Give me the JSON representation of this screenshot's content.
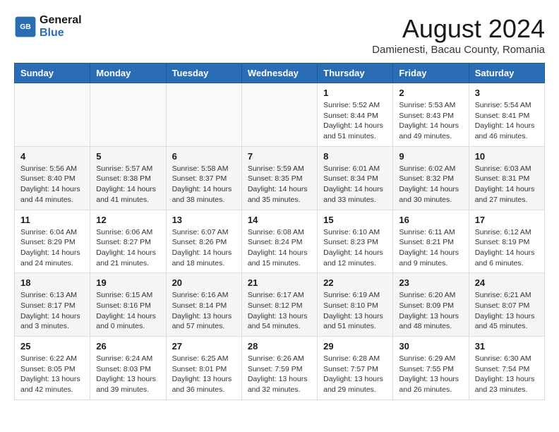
{
  "header": {
    "logo_line1": "General",
    "logo_line2": "Blue",
    "month_year": "August 2024",
    "location": "Damienesti, Bacau County, Romania"
  },
  "weekdays": [
    "Sunday",
    "Monday",
    "Tuesday",
    "Wednesday",
    "Thursday",
    "Friday",
    "Saturday"
  ],
  "weeks": [
    [
      {
        "day": "",
        "info": ""
      },
      {
        "day": "",
        "info": ""
      },
      {
        "day": "",
        "info": ""
      },
      {
        "day": "",
        "info": ""
      },
      {
        "day": "1",
        "info": "Sunrise: 5:52 AM\nSunset: 8:44 PM\nDaylight: 14 hours\nand 51 minutes."
      },
      {
        "day": "2",
        "info": "Sunrise: 5:53 AM\nSunset: 8:43 PM\nDaylight: 14 hours\nand 49 minutes."
      },
      {
        "day": "3",
        "info": "Sunrise: 5:54 AM\nSunset: 8:41 PM\nDaylight: 14 hours\nand 46 minutes."
      }
    ],
    [
      {
        "day": "4",
        "info": "Sunrise: 5:56 AM\nSunset: 8:40 PM\nDaylight: 14 hours\nand 44 minutes."
      },
      {
        "day": "5",
        "info": "Sunrise: 5:57 AM\nSunset: 8:38 PM\nDaylight: 14 hours\nand 41 minutes."
      },
      {
        "day": "6",
        "info": "Sunrise: 5:58 AM\nSunset: 8:37 PM\nDaylight: 14 hours\nand 38 minutes."
      },
      {
        "day": "7",
        "info": "Sunrise: 5:59 AM\nSunset: 8:35 PM\nDaylight: 14 hours\nand 35 minutes."
      },
      {
        "day": "8",
        "info": "Sunrise: 6:01 AM\nSunset: 8:34 PM\nDaylight: 14 hours\nand 33 minutes."
      },
      {
        "day": "9",
        "info": "Sunrise: 6:02 AM\nSunset: 8:32 PM\nDaylight: 14 hours\nand 30 minutes."
      },
      {
        "day": "10",
        "info": "Sunrise: 6:03 AM\nSunset: 8:31 PM\nDaylight: 14 hours\nand 27 minutes."
      }
    ],
    [
      {
        "day": "11",
        "info": "Sunrise: 6:04 AM\nSunset: 8:29 PM\nDaylight: 14 hours\nand 24 minutes."
      },
      {
        "day": "12",
        "info": "Sunrise: 6:06 AM\nSunset: 8:27 PM\nDaylight: 14 hours\nand 21 minutes."
      },
      {
        "day": "13",
        "info": "Sunrise: 6:07 AM\nSunset: 8:26 PM\nDaylight: 14 hours\nand 18 minutes."
      },
      {
        "day": "14",
        "info": "Sunrise: 6:08 AM\nSunset: 8:24 PM\nDaylight: 14 hours\nand 15 minutes."
      },
      {
        "day": "15",
        "info": "Sunrise: 6:10 AM\nSunset: 8:23 PM\nDaylight: 14 hours\nand 12 minutes."
      },
      {
        "day": "16",
        "info": "Sunrise: 6:11 AM\nSunset: 8:21 PM\nDaylight: 14 hours\nand 9 minutes."
      },
      {
        "day": "17",
        "info": "Sunrise: 6:12 AM\nSunset: 8:19 PM\nDaylight: 14 hours\nand 6 minutes."
      }
    ],
    [
      {
        "day": "18",
        "info": "Sunrise: 6:13 AM\nSunset: 8:17 PM\nDaylight: 14 hours\nand 3 minutes."
      },
      {
        "day": "19",
        "info": "Sunrise: 6:15 AM\nSunset: 8:16 PM\nDaylight: 14 hours\nand 0 minutes."
      },
      {
        "day": "20",
        "info": "Sunrise: 6:16 AM\nSunset: 8:14 PM\nDaylight: 13 hours\nand 57 minutes."
      },
      {
        "day": "21",
        "info": "Sunrise: 6:17 AM\nSunset: 8:12 PM\nDaylight: 13 hours\nand 54 minutes."
      },
      {
        "day": "22",
        "info": "Sunrise: 6:19 AM\nSunset: 8:10 PM\nDaylight: 13 hours\nand 51 minutes."
      },
      {
        "day": "23",
        "info": "Sunrise: 6:20 AM\nSunset: 8:09 PM\nDaylight: 13 hours\nand 48 minutes."
      },
      {
        "day": "24",
        "info": "Sunrise: 6:21 AM\nSunset: 8:07 PM\nDaylight: 13 hours\nand 45 minutes."
      }
    ],
    [
      {
        "day": "25",
        "info": "Sunrise: 6:22 AM\nSunset: 8:05 PM\nDaylight: 13 hours\nand 42 minutes."
      },
      {
        "day": "26",
        "info": "Sunrise: 6:24 AM\nSunset: 8:03 PM\nDaylight: 13 hours\nand 39 minutes."
      },
      {
        "day": "27",
        "info": "Sunrise: 6:25 AM\nSunset: 8:01 PM\nDaylight: 13 hours\nand 36 minutes."
      },
      {
        "day": "28",
        "info": "Sunrise: 6:26 AM\nSunset: 7:59 PM\nDaylight: 13 hours\nand 32 minutes."
      },
      {
        "day": "29",
        "info": "Sunrise: 6:28 AM\nSunset: 7:57 PM\nDaylight: 13 hours\nand 29 minutes."
      },
      {
        "day": "30",
        "info": "Sunrise: 6:29 AM\nSunset: 7:55 PM\nDaylight: 13 hours\nand 26 minutes."
      },
      {
        "day": "31",
        "info": "Sunrise: 6:30 AM\nSunset: 7:54 PM\nDaylight: 13 hours\nand 23 minutes."
      }
    ]
  ]
}
